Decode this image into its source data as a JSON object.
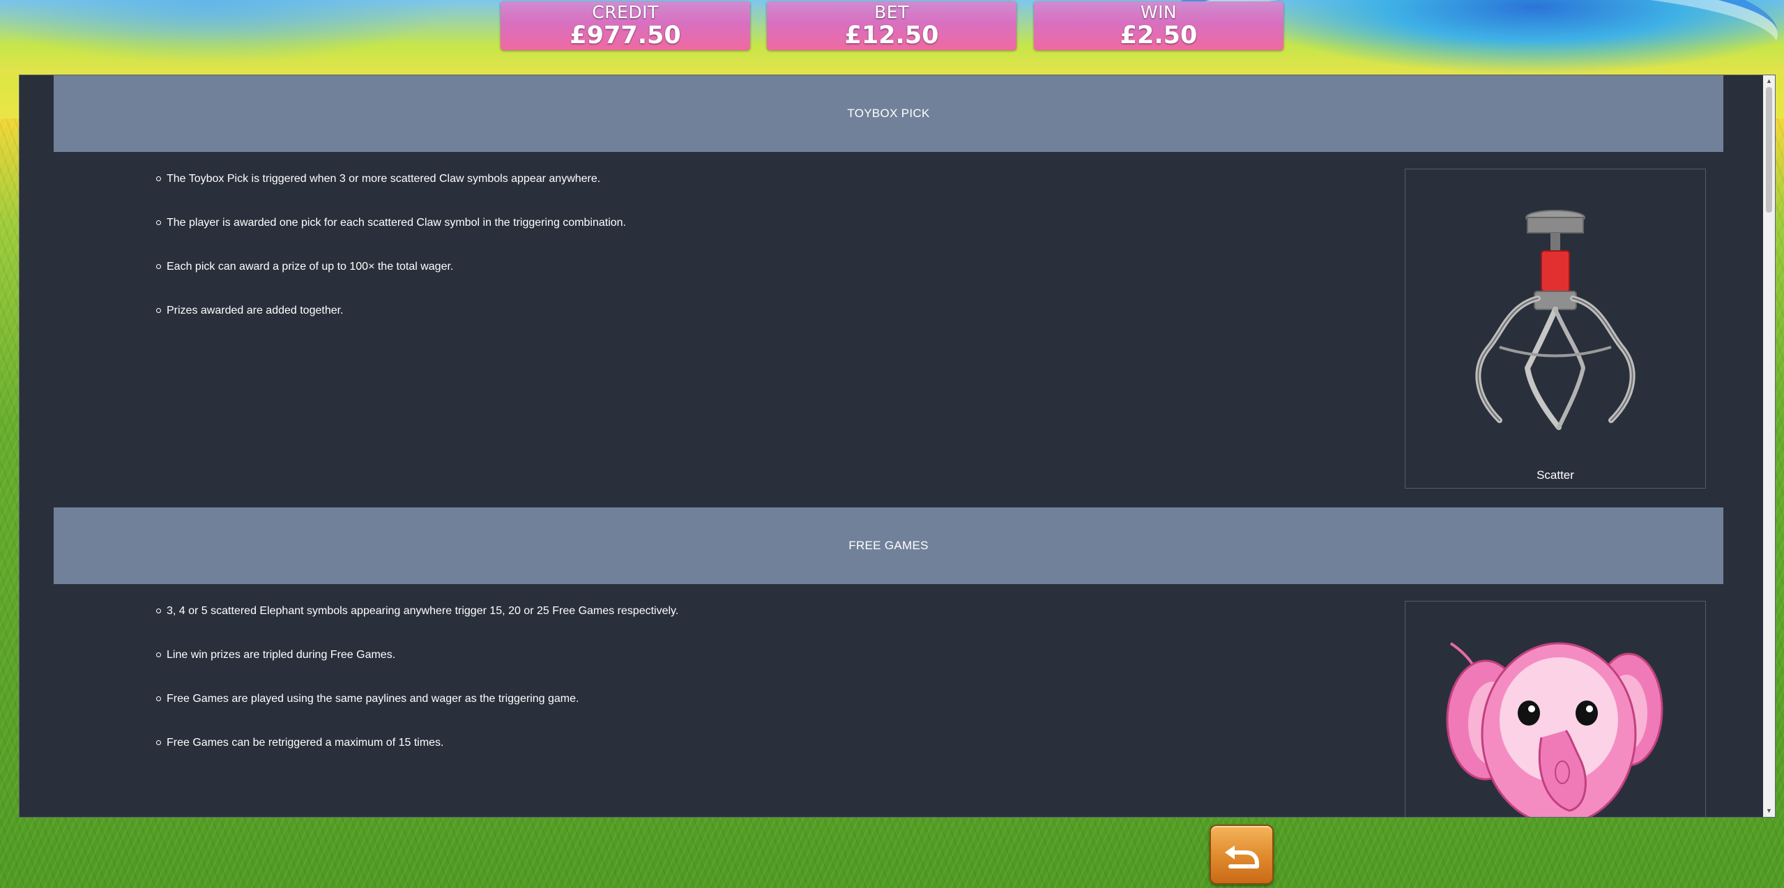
{
  "meters": {
    "credit": {
      "label": "CREDIT",
      "value": "£977.50"
    },
    "bet": {
      "label": "BET",
      "value": "£12.50"
    },
    "win": {
      "label": "WIN",
      "value": "£2.50"
    }
  },
  "help": {
    "sections": [
      {
        "title": "TOYBOX PICK",
        "rules": [
          "The Toybox Pick is triggered when 3 or more scattered Claw symbols appear anywhere.",
          "The player is awarded one pick for each scattered Claw symbol in the triggering combination.",
          "Each pick can award a prize of up to 100× the total wager.",
          "Prizes awarded are added together."
        ],
        "symbol": {
          "icon": "claw-icon",
          "caption": "Scatter"
        }
      },
      {
        "title": "FREE GAMES",
        "rules": [
          "3, 4 or 5 scattered Elephant symbols appearing anywhere trigger 15, 20 or 25 Free Games respectively.",
          "Line win prizes are tripled during Free Games.",
          "Free Games are played using the same paylines and wager as the triggering game.",
          "Free Games can be retriggered a maximum of 15 times."
        ],
        "symbol": {
          "icon": "elephant-icon",
          "caption": ""
        }
      }
    ]
  },
  "controls": {
    "back_icon": "back-arrow-icon"
  },
  "colors": {
    "panel_background": "#29303b",
    "section_header": "#718199",
    "meter_top": "#cf8cd0",
    "meter_bottom": "#f06aa0",
    "back_button": "#e0892c"
  }
}
